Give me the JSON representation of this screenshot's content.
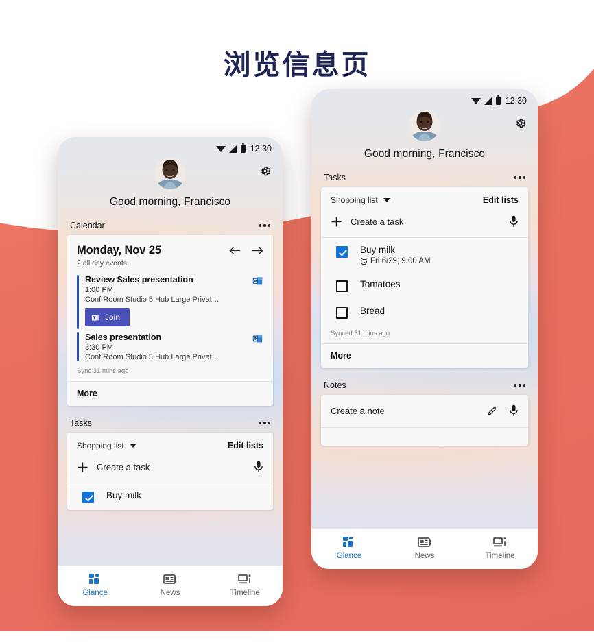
{
  "page": {
    "title": "浏览信息页",
    "title_color": "#1f2452",
    "background_color": "#e9705f"
  },
  "status_bar": {
    "time": "12:30",
    "icons": [
      "wifi-icon",
      "signal-icon",
      "battery-icon"
    ]
  },
  "greeting": {
    "text": "Good morning, Francisco",
    "settings_icon": "gear-icon",
    "avatar": "user-avatar"
  },
  "calendar": {
    "section_label": "Calendar",
    "overflow_icon": "more-options-icon",
    "date": "Monday, Nov 25",
    "subtitle": "2 all day events",
    "prev_icon": "arrow-left-icon",
    "next_icon": "arrow-right-icon",
    "events": [
      {
        "title": "Review Sales presentation",
        "time": "1:00 PM",
        "location": "Conf Room Studio 5 Hub Large Privat…",
        "app_icon": "outlook-icon",
        "join_label": "Join",
        "join_icon": "teams-icon",
        "accent": "#2a53c1"
      },
      {
        "title": "Sales presentation",
        "time": "3:30 PM",
        "location": "Conf Room Studio 5 Hub Large Privat…",
        "app_icon": "outlook-icon",
        "accent": "#2a53c1"
      }
    ],
    "sync_status": "Sync 31 mins ago",
    "more_label": "More"
  },
  "tasks": {
    "section_label": "Tasks",
    "overflow_icon": "more-options-icon",
    "list_name": "Shopping list",
    "list_caret_icon": "chevron-down-icon",
    "edit_lists_label": "Edit lists",
    "create_label": "Create a task",
    "create_icon": "plus-icon",
    "mic_icon": "microphone-icon",
    "items": [
      {
        "title": "Buy milk",
        "due": "Fri 6/29, 9:00 AM",
        "due_icon": "alarm-icon",
        "checked": true
      },
      {
        "title": "Tomatoes",
        "due": "",
        "checked": false
      },
      {
        "title": "Bread",
        "due": "",
        "checked": false
      }
    ],
    "sync_status": "Synced 31 mins ago",
    "more_label": "More",
    "checked_color": "#1274d8"
  },
  "notes": {
    "section_label": "Notes",
    "overflow_icon": "more-options-icon",
    "create_label": "Create a note",
    "pencil_icon": "pencil-icon",
    "mic_icon": "microphone-icon"
  },
  "bottom_nav": {
    "active_color": "#1a73c4",
    "items": [
      {
        "label": "Glance",
        "icon": "glance-icon",
        "active": true
      },
      {
        "label": "News",
        "icon": "news-icon",
        "active": false
      },
      {
        "label": "Timeline",
        "icon": "timeline-icon",
        "active": false
      }
    ]
  }
}
